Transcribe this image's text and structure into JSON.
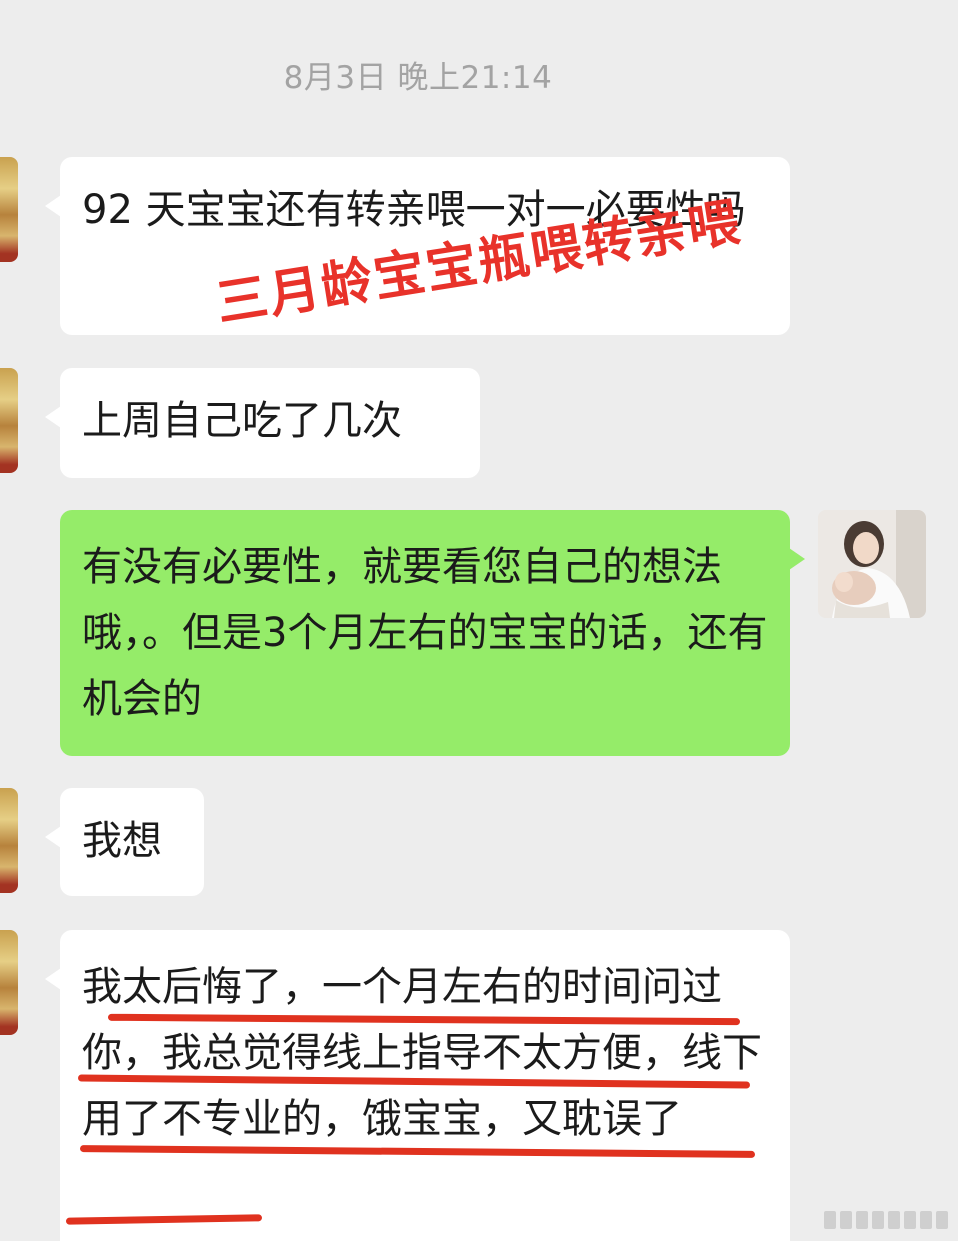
{
  "chat": {
    "timestamp": "8月3日 晚上21:14",
    "messages": [
      {
        "side": "left",
        "text": "92 天宝宝还有转亲喂一对一必要性吗"
      },
      {
        "side": "left",
        "text": "上周自己吃了几次"
      },
      {
        "side": "right",
        "text": "有没有必要性，就要看您自己的想法哦，。但是3个月左右的宝宝的话，还有机会的"
      },
      {
        "side": "left",
        "text": "我想"
      },
      {
        "side": "left",
        "text": "我太后悔了，一个月左右的时间问过你，我总觉得线上指导不太方便，线下用了不专业的，饿宝宝，又耽误了"
      }
    ]
  },
  "overlay": {
    "caption": "三月龄宝宝瓶喂转亲喂",
    "color": "#e8322a"
  },
  "colors": {
    "background": "#ededed",
    "incoming_bubble": "#ffffff",
    "outgoing_bubble": "#95ec69",
    "underline": "#e0321f"
  }
}
